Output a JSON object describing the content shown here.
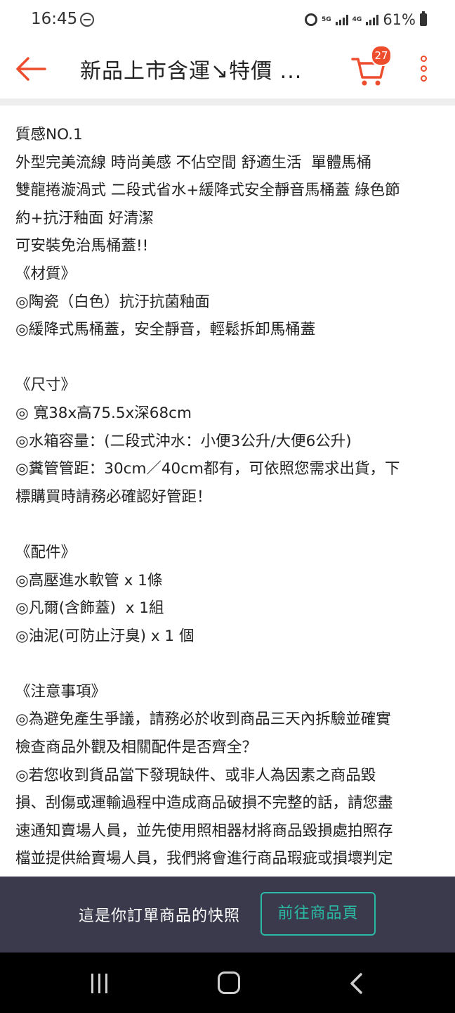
{
  "status_bar": {
    "time": "16:45",
    "network_1": "5G",
    "network_2": "4G",
    "battery": "61%",
    "icons": [
      "do-not-disturb-icon",
      "alarm-icon",
      "signal-icon",
      "signal-icon",
      "battery-icon"
    ]
  },
  "header": {
    "title": "新品上市含運↘特價 ...",
    "cart_count": "27",
    "accent_color": "#ee4d2d",
    "icons": [
      "back-arrow-icon",
      "cart-icon",
      "more-vertical-icon"
    ]
  },
  "content": {
    "lines": [
      "質感NO.1",
      "外型完美流線 時尚美感 不佔空間 舒適生活  單體馬桶",
      "雙龍捲漩渦式 二段式省水+緩降式安全靜音馬桶蓋 綠色節",
      "約+抗汙釉面 好清潔",
      "可安裝免治馬桶蓋!!",
      "《材質》",
      "◎陶瓷（白色）抗汙抗菌釉面",
      "◎緩降式馬桶蓋，安全靜音，輕鬆拆卸馬桶蓋",
      "",
      "《尺寸》",
      "◎ 寬38x高75.5x深68cm",
      "◎水箱容量：(二段式沖水：小便3公升/大便6公升)",
      "◎糞管管距：30cm／40cm都有，可依照您需求出貨，下",
      "標購買時請務必確認好管距！",
      "",
      "《配件》",
      "◎高壓進水軟管 x 1條",
      "◎凡爾(含飾蓋)  x 1組",
      "◎油泥(可防止汙臭) x 1 個",
      "",
      "《注意事項》",
      "◎為避免產生爭議，請務必於收到商品三天內拆驗並確實",
      "檢查商品外觀及相關配件是否齊全？",
      "◎若您收到貨品當下發現缺件、或非人為因素之商品毀",
      "損、刮傷或運輸過程中造成商品破損不完整的話，請您盡",
      "速通知賣場人員，並先使用照相器材將商品毀損處拍照存",
      "檔並提供給賣場人員，我們將會進行商品瑕疵或損壞判定"
    ]
  },
  "snapshot_bar": {
    "text": "這是你訂單商品的快照",
    "button_label": "前往商品頁",
    "button_color": "#2bb9a5"
  },
  "nav_bar": {
    "icons": [
      "recents-icon",
      "home-icon",
      "back-icon"
    ]
  }
}
